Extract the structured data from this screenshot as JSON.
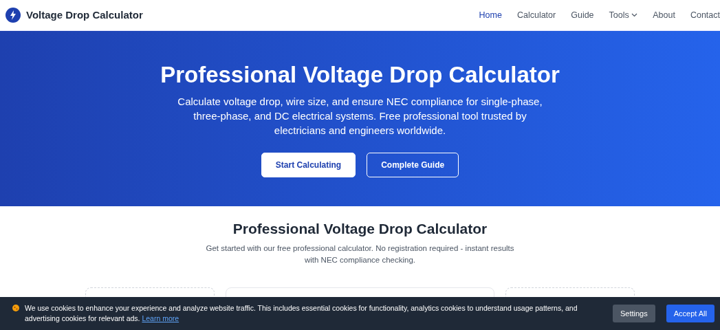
{
  "brand": {
    "title": "Voltage Drop Calculator"
  },
  "nav": [
    {
      "label": "Home",
      "selected": true,
      "dropdown": false
    },
    {
      "label": "Calculator",
      "selected": false,
      "dropdown": false
    },
    {
      "label": "Guide",
      "selected": false,
      "dropdown": false
    },
    {
      "label": "Tools",
      "selected": false,
      "dropdown": true
    },
    {
      "label": "About",
      "selected": false,
      "dropdown": false
    },
    {
      "label": "Contact",
      "selected": false,
      "dropdown": false
    }
  ],
  "hero": {
    "title": "Professional Voltage Drop Calculator",
    "text": "Calculate voltage drop, wire size, and ensure NEC compliance for single-phase, three-phase, and DC electrical systems. Free professional tool trusted by electricians and engineers worldwide.",
    "buttons": [
      {
        "label": "Start Calculating",
        "kind": "primary"
      },
      {
        "label": "Complete Guide",
        "kind": "outline"
      }
    ]
  },
  "section": {
    "title": "Professional Voltage Drop Calculator",
    "text": "Get started with our free professional calculator. No registration required - instant results with NEC compliance checking.",
    "panels": [
      {
        "kind": "dashed"
      },
      {
        "kind": "solid"
      },
      {
        "kind": "dashed"
      }
    ]
  },
  "cookie_banner": {
    "text": "We use cookies to enhance your experience and analyze website traffic. This includes essential cookies for functionality, analytics cookies to understand usage patterns, and advertising cookies for relevant ads.",
    "link": "Learn more",
    "buttons": [
      {
        "label": "Settings",
        "kind": "secondary"
      },
      {
        "label": "Accept All",
        "kind": "primary"
      }
    ]
  }
}
